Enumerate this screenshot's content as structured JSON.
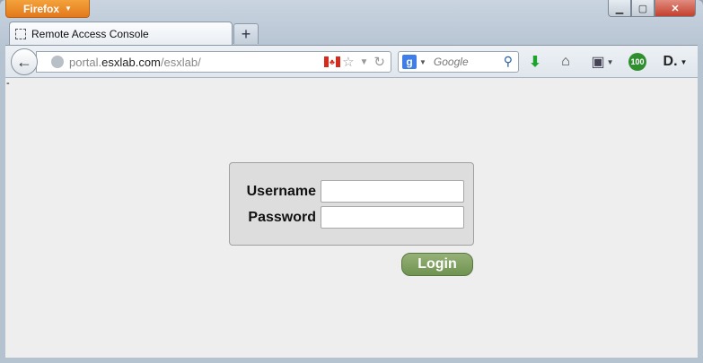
{
  "browser": {
    "menu_button": "Firefox",
    "tab_title": "Remote Access Console",
    "new_tab_label": "+",
    "url_prefix": "portal.",
    "url_domain": "esxlab.com",
    "url_path": "/esxlab/",
    "search_placeholder": "Google",
    "search_engine_letter": "g",
    "addon_badge": "100",
    "addon_letter": "D."
  },
  "page": {
    "stray_text": "-",
    "username_label": "Username",
    "password_label": "Password",
    "username_value": "",
    "password_value": "",
    "login_label": "Login"
  },
  "colors": {
    "login_button": "#7d9f5f",
    "page_background": "#eeeeee",
    "firefox_button": "#e88a2a"
  }
}
